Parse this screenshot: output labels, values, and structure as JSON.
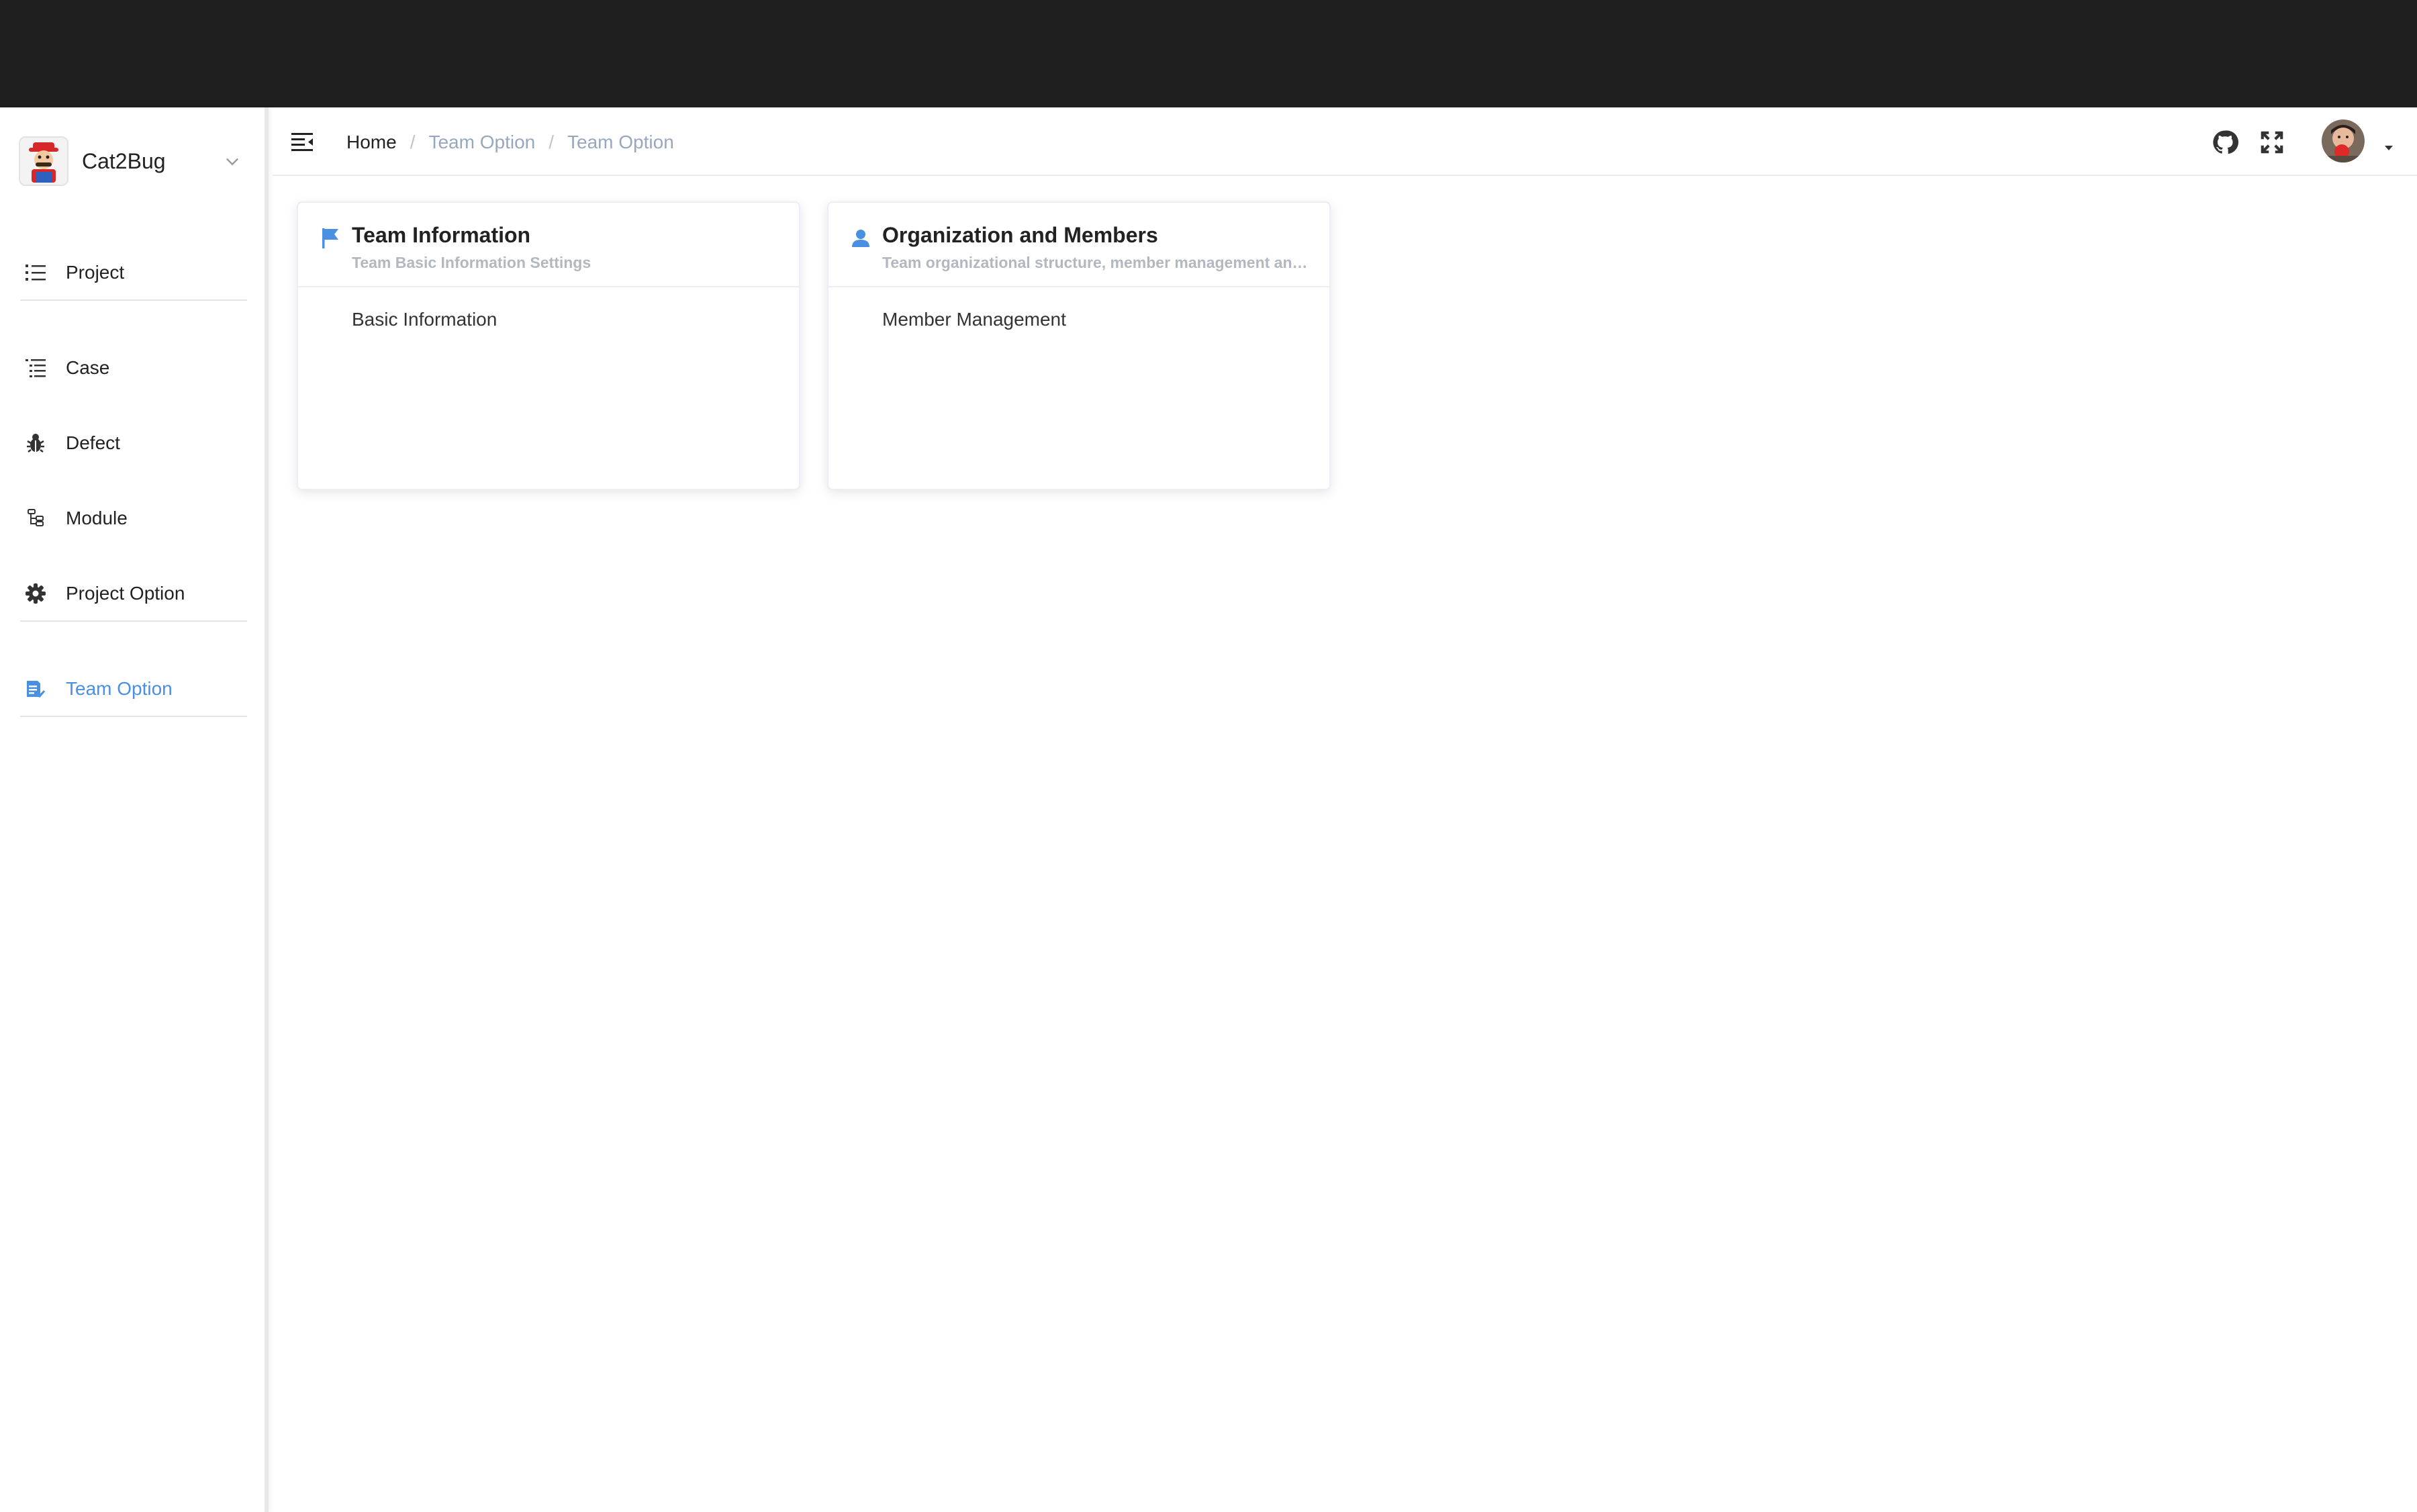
{
  "app": {
    "name": "Cat2Bug"
  },
  "sidebar": {
    "items": [
      {
        "label": "Project",
        "icon": "list-icon"
      },
      {
        "label": "Case",
        "icon": "tree-list-icon"
      },
      {
        "label": "Defect",
        "icon": "bug-icon"
      },
      {
        "label": "Module",
        "icon": "module-tree-icon"
      },
      {
        "label": "Project Option",
        "icon": "gear-icon"
      },
      {
        "label": "Team Option",
        "icon": "team-doc-icon",
        "active": true
      }
    ]
  },
  "header": {
    "breadcrumb": [
      "Home",
      "Team Option",
      "Team Option"
    ],
    "separator": "/"
  },
  "cards": [
    {
      "title": "Team Information",
      "subtitle": "Team Basic Information Settings",
      "icon": "flag-icon",
      "link": "Basic Information"
    },
    {
      "title": "Organization and Members",
      "subtitle": "Team organizational structure, member management and permission settings",
      "icon": "user-icon",
      "link": "Member Management"
    }
  ],
  "colors": {
    "accent": "#4a90e2",
    "topbar": "#1f1f1f",
    "breadcrumb_muted": "#97a8be"
  }
}
